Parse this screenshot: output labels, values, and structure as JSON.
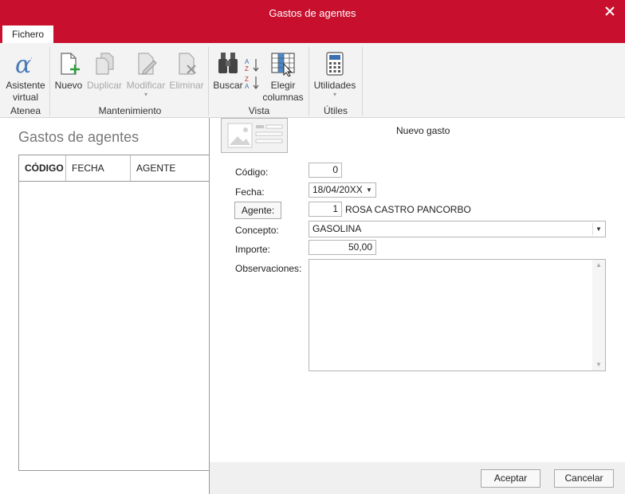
{
  "window": {
    "title": "Gastos de agentes",
    "close_icon": "close-icon"
  },
  "tabs": [
    {
      "label": "Fichero",
      "active": true
    }
  ],
  "ribbon": {
    "atenea": {
      "label": "Atenea",
      "assistant_line1": "Asistente",
      "assistant_line2": "virtual"
    },
    "mantenimiento": {
      "label": "Mantenimiento",
      "nuevo": "Nuevo",
      "duplicar": "Duplicar",
      "modificar": "Modificar",
      "eliminar": "Eliminar",
      "modificar_caret": "▾"
    },
    "vista": {
      "label": "Vista",
      "buscar": "Buscar",
      "elegir_line1": "Elegir",
      "elegir_line2": "columnas"
    },
    "utiles": {
      "label": "Útiles",
      "utilidades": "Utilidades",
      "utilidades_caret": "▾"
    }
  },
  "list": {
    "title": "Gastos de agentes",
    "columns": [
      "CÓDIGO",
      "FECHA",
      "AGENTE"
    ],
    "rows": []
  },
  "form": {
    "title": "Nuevo gasto",
    "codigo_label": "Código:",
    "codigo_value": "0",
    "fecha_label": "Fecha:",
    "fecha_value": "18/04/20XX",
    "agente_button": "Agente:",
    "agente_code": "1",
    "agente_name": "ROSA CASTRO PANCORBO",
    "concepto_label": "Concepto:",
    "concepto_value": "GASOLINA",
    "importe_label": "Importe:",
    "importe_value": "50,00",
    "observaciones_label": "Observaciones:",
    "observaciones_value": ""
  },
  "footer": {
    "accept": "Aceptar",
    "cancel": "Cancelar"
  },
  "colors": {
    "brand": "#c8102e",
    "ribbon_bg": "#f3f3f3",
    "add_green": "#2e9d3a"
  }
}
